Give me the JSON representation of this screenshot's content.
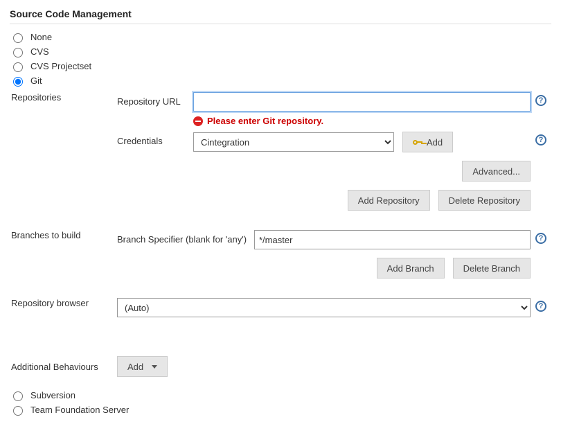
{
  "section_title": "Source Code Management",
  "scm_options": {
    "none": "None",
    "cvs": "CVS",
    "cvs_projectset": "CVS Projectset",
    "git": "Git",
    "subversion": "Subversion",
    "tfs": "Team Foundation Server"
  },
  "git": {
    "repositories_label": "Repositories",
    "repo_url_label": "Repository URL",
    "repo_url_value": "",
    "repo_url_error": "Please enter Git repository.",
    "credentials_label": "Credentials",
    "credentials_selected": "Cintegration",
    "add_button": "Add",
    "advanced_button": "Advanced...",
    "add_repo_button": "Add Repository",
    "delete_repo_button": "Delete Repository"
  },
  "branches": {
    "section_label": "Branches to build",
    "specifier_label": "Branch Specifier (blank for 'any')",
    "specifier_value": "*/master",
    "add_branch_button": "Add Branch",
    "delete_branch_button": "Delete Branch"
  },
  "repo_browser": {
    "label": "Repository browser",
    "selected": "(Auto)"
  },
  "additional_behaviours": {
    "label": "Additional Behaviours",
    "add_button": "Add"
  },
  "help_glyph": "?"
}
